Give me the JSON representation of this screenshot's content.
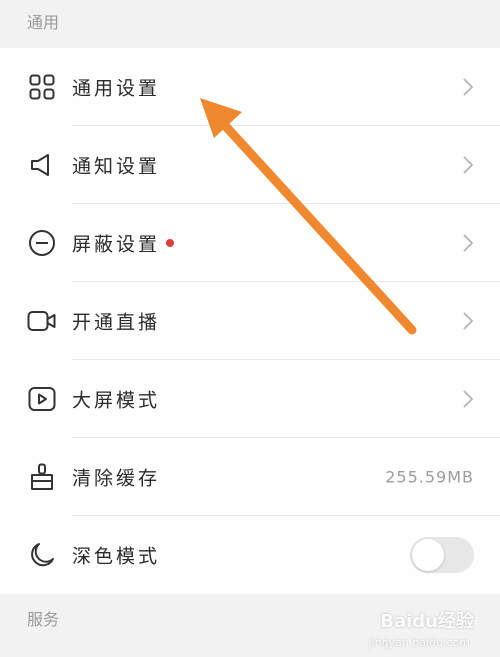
{
  "sections": {
    "general_title": "通用",
    "services_title": "服务"
  },
  "items": [
    {
      "label": "通用设置",
      "icon": "grid-icon"
    },
    {
      "label": "通知设置",
      "icon": "speaker-icon"
    },
    {
      "label": "屏蔽设置",
      "icon": "block-icon",
      "badge": "red-dot"
    },
    {
      "label": "开通直播",
      "icon": "video-camera-icon"
    },
    {
      "label": "大屏模式",
      "icon": "play-screen-icon"
    },
    {
      "label": "清除缓存",
      "icon": "brush-icon",
      "value": "255.59MB"
    },
    {
      "label": "深色模式",
      "icon": "moon-icon",
      "toggle": false
    }
  ],
  "annotation": {
    "color": "#f0882f",
    "points_to": "通用设置"
  },
  "watermark": {
    "brand": "Baidu经验",
    "sub": "jingyan.baidu.com"
  },
  "colors": {
    "badge": "#e03b3b",
    "accent_arrow": "#f0882f"
  }
}
